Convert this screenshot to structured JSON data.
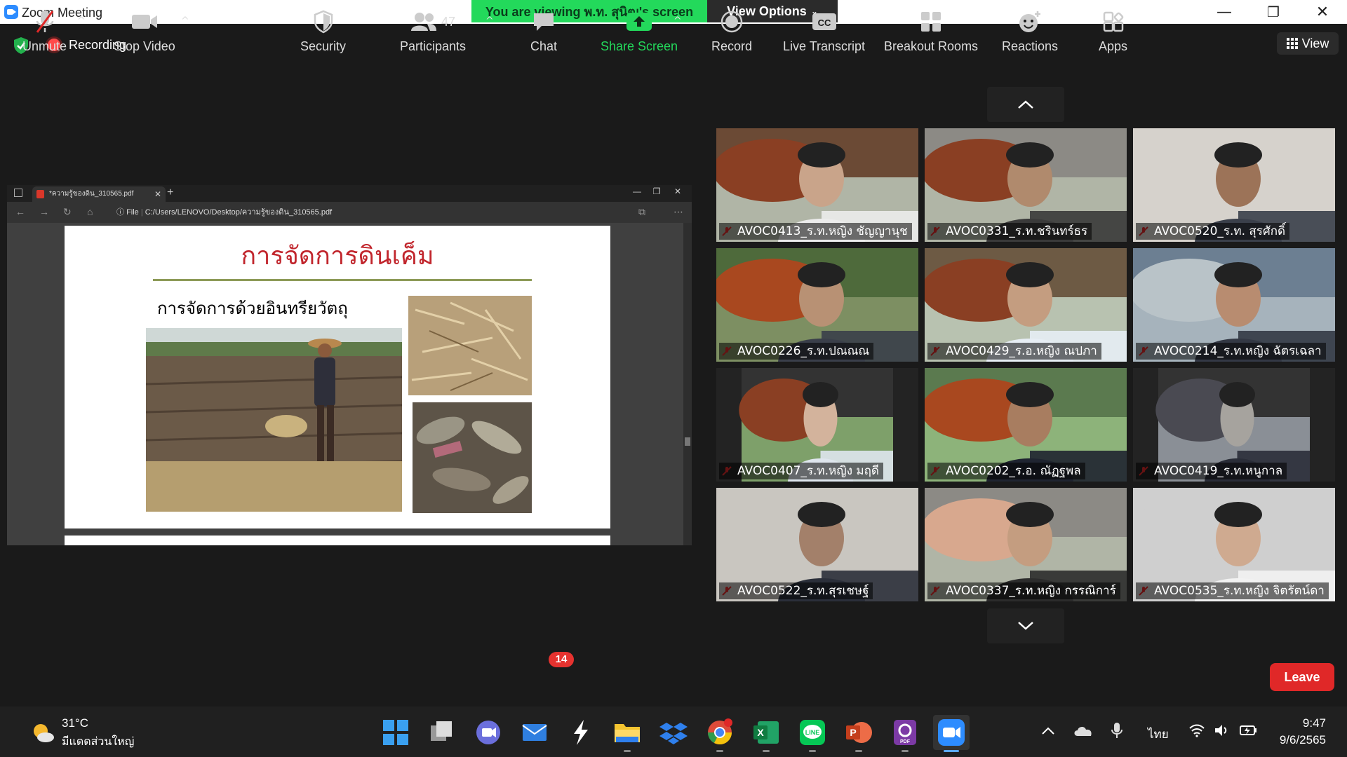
{
  "window": {
    "title": "Zoom Meeting",
    "minimize": "—",
    "maximize": "❐",
    "close": "✕"
  },
  "banner": {
    "viewing_text": "You are viewing พ.ท. สุนิฒ's screen",
    "view_options_label": "View Options",
    "accent": "#23d95b"
  },
  "status": {
    "recording_label": "Recording",
    "view_label": "View"
  },
  "shared_screen": {
    "tab_title": "*ความรู้ของดิน_310565.pdf",
    "address_prefix": "File",
    "address": "C:/Users/LENOVO/Desktop/ความรู้ของดิน_310565.pdf",
    "slide_title": "การจัดการดินเค็ม",
    "slide_subtitle": "การจัดการด้วยอินทรียวัตถุ"
  },
  "participants_grid": [
    {
      "name": "AVOC0413_ร.ท.หญิง ชัญญานุช",
      "muted": true
    },
    {
      "name": "AVOC0331_ร.ท.ชรินทร์ธร",
      "muted": true
    },
    {
      "name": "AVOC0520_ร.ท. สุรศักดิ์",
      "muted": true
    },
    {
      "name": "AVOC0226_ร.ท.ปณณณ",
      "muted": true
    },
    {
      "name": "AVOC0429_ร.อ.หญิง ณปภา",
      "muted": true
    },
    {
      "name": "AVOC0214_ร.ท.หญิง ฉัตรเฉลา",
      "muted": true
    },
    {
      "name": "AVOC0407_ร.ท.หญิง มฤดี",
      "muted": true
    },
    {
      "name": "AVOC0202_ร.อ. ณัฏฐพล",
      "muted": true
    },
    {
      "name": "AVOC0419_ร.ท.หนูกาล",
      "muted": true
    },
    {
      "name": "AVOC0522_ร.ท.สุรเชษฐ์",
      "muted": true
    },
    {
      "name": "AVOC0337_ร.ท.หญิง กรรณิการ์",
      "muted": true
    },
    {
      "name": "AVOC0535_ร.ท.หญิง จิตรัตน์ดา",
      "muted": true
    }
  ],
  "toolbar": {
    "unmute": "Unmute",
    "stop_video": "Stop Video",
    "security": "Security",
    "participants": "Participants",
    "participants_count": "47",
    "chat": "Chat",
    "chat_badge": "14",
    "share_screen": "Share Screen",
    "record": "Record",
    "live_transcript": "Live Transcript",
    "breakout_rooms": "Breakout Rooms",
    "reactions": "Reactions",
    "apps": "Apps",
    "leave": "Leave",
    "leave_color": "#e02828",
    "share_color": "#23d95b"
  },
  "taskbar": {
    "temperature": "31°C",
    "weather": "มีแดดส่วนใหญ่",
    "language": "ไทย",
    "time": "9:47",
    "date": "9/6/2565",
    "apps": [
      "windows-start-icon",
      "task-view-icon",
      "teams-chat-icon",
      "mail-icon",
      "lightning-app-icon",
      "file-explorer-icon",
      "dropbox-icon",
      "chrome-icon",
      "excel-icon",
      "line-icon",
      "powerpoint-icon",
      "pdf-app-icon",
      "zoom-icon"
    ]
  }
}
